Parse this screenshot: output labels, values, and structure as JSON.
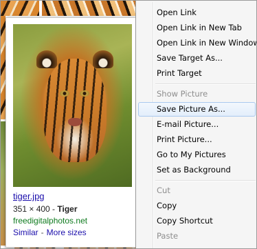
{
  "hover_card": {
    "filename": "tiger.jpg",
    "dimensions": "351 × 400",
    "dimension_separator": " - ",
    "title": "Tiger",
    "source": "freedigitalphotos.net",
    "similar_link": "Similar",
    "link_separator": "-",
    "more_sizes_link": "More sizes"
  },
  "context_menu": {
    "items": [
      {
        "label": "Open Link",
        "enabled": true
      },
      {
        "label": "Open Link in New Tab",
        "enabled": true
      },
      {
        "label": "Open Link in New Window",
        "enabled": true
      },
      {
        "label": "Save Target As...",
        "enabled": true
      },
      {
        "label": "Print Target",
        "enabled": true
      },
      {
        "label": "Show Picture",
        "enabled": false
      },
      {
        "label": "Save Picture As...",
        "enabled": true,
        "highlighted": true
      },
      {
        "label": "E-mail Picture...",
        "enabled": true
      },
      {
        "label": "Print Picture...",
        "enabled": true
      },
      {
        "label": "Go to My Pictures",
        "enabled": true
      },
      {
        "label": "Set as Background",
        "enabled": true
      },
      {
        "label": "Cut",
        "enabled": false
      },
      {
        "label": "Copy",
        "enabled": true
      },
      {
        "label": "Copy Shortcut",
        "enabled": true
      },
      {
        "label": "Paste",
        "enabled": false
      }
    ]
  },
  "colors": {
    "link": "#1a0dab",
    "source_green": "#0e7a1e",
    "menu_bg": "#f5f5f5",
    "menu_disabled": "#8d8d8d",
    "menu_highlight_border": "#a9c9ef"
  }
}
